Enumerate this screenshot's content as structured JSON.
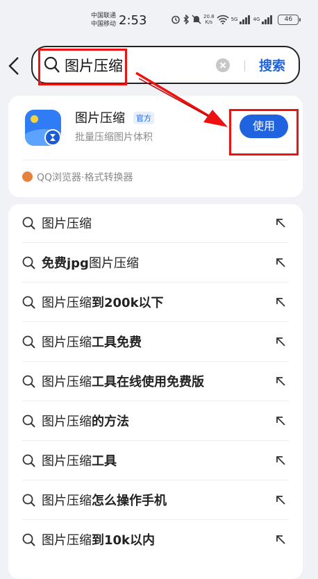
{
  "status": {
    "carrier1": "中国联通",
    "carrier2": "中国移动",
    "time": "2:53",
    "speed": "20.8",
    "speed_unit": "K/s",
    "net1": "5G",
    "net2": "4G",
    "battery": "46"
  },
  "search": {
    "query": "图片压缩",
    "button": "搜索"
  },
  "app": {
    "name": "图片压缩",
    "tag": "官方",
    "desc": "批量压缩图片体积",
    "use": "使用",
    "source": "QQ浏览器·格式转换器"
  },
  "suggestions": [
    {
      "plain": "图片压缩",
      "bold": ""
    },
    {
      "plain": "",
      "bold": "免费jpg",
      "plain2": "图片压缩"
    },
    {
      "plain": "图片压缩",
      "bold": "到200k以下"
    },
    {
      "plain": "图片压缩",
      "bold": "工具免费"
    },
    {
      "plain": "图片压缩",
      "bold": "工具在线使用免费版"
    },
    {
      "plain": "图片压缩",
      "bold": "的方法"
    },
    {
      "plain": "图片压缩",
      "bold": "工具"
    },
    {
      "plain": "图片压缩",
      "bold": "怎么操作手机"
    },
    {
      "plain": "图片压缩",
      "bold": "到10k以内"
    }
  ],
  "colors": {
    "accent": "#1f63e0",
    "highlight": "#ee1111"
  }
}
